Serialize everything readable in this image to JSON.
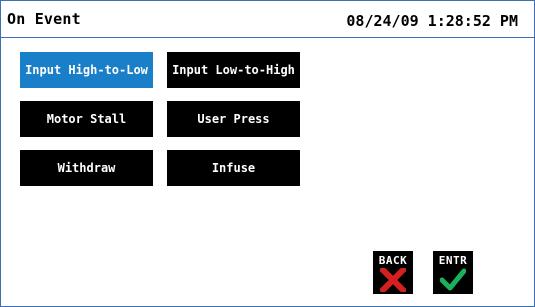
{
  "header": {
    "title": "On Event",
    "datetime": "08/24/09 1:28:52 PM"
  },
  "options": [
    {
      "label": "Input High-to-Low",
      "selected": true
    },
    {
      "label": "Input Low-to-High",
      "selected": false
    },
    {
      "label": "Motor Stall",
      "selected": false
    },
    {
      "label": "User Press",
      "selected": false
    },
    {
      "label": "Withdraw",
      "selected": false
    },
    {
      "label": "Infuse",
      "selected": false
    }
  ],
  "nav": {
    "back_label": "BACK",
    "enter_label": "ENTR"
  },
  "colors": {
    "selected": "#1a7fc9",
    "button": "#000000",
    "border": "#3b6fb6",
    "back_x": "#d42020",
    "enter_check": "#19b15a"
  },
  "icons": {
    "back": "close-x-icon",
    "enter": "checkmark-icon"
  }
}
